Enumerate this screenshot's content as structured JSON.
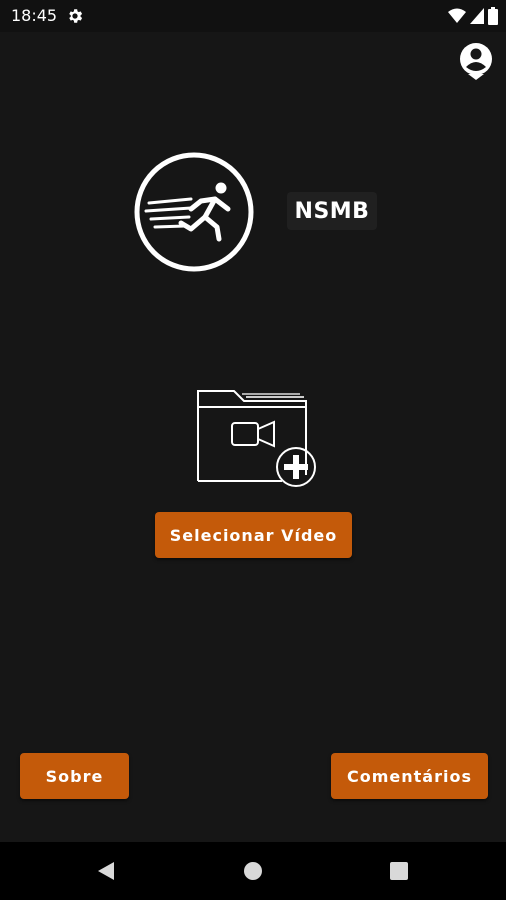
{
  "status_bar": {
    "time": "18:45",
    "icons": [
      "settings-icon",
      "wifi-icon",
      "signal-icon",
      "battery-icon"
    ]
  },
  "header": {
    "account_icon": "account-circle-icon"
  },
  "logo": {
    "icon": "running-person-icon",
    "app_name": "NSMB"
  },
  "main": {
    "illustration_icon": "video-folder-add-icon",
    "select_video_label": "Selecionar Vídeo"
  },
  "footer": {
    "about_label": "Sobre",
    "comments_label": "Comentários"
  },
  "nav_bar": {
    "icons": [
      "back-icon",
      "home-icon",
      "recents-icon"
    ]
  },
  "colors": {
    "background": "#161616",
    "accent": "#c45a0a",
    "text": "#ffffff",
    "status_bar": "#111111",
    "nav_bar": "#000000"
  }
}
